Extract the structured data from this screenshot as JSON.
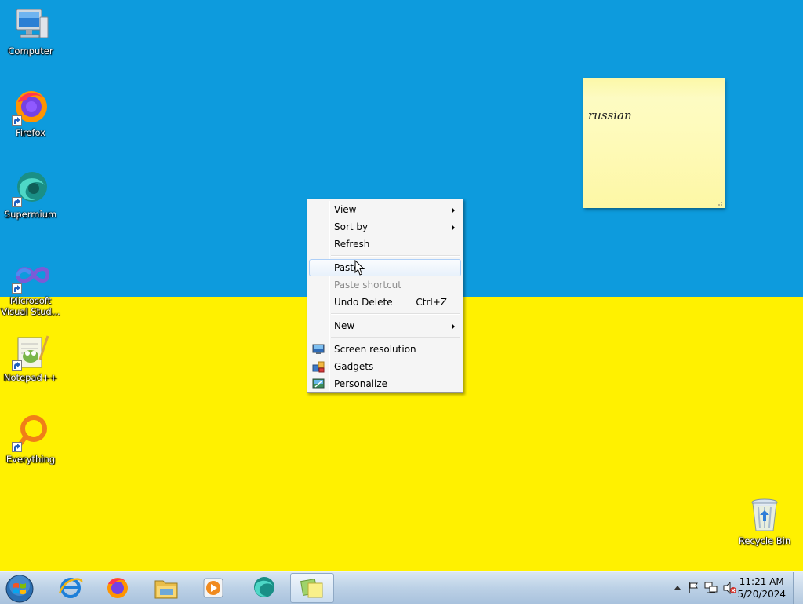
{
  "desktop": {
    "colors": {
      "top": "#0d9bdd",
      "bottom": "#fff100"
    },
    "icons": [
      {
        "label": "Computer",
        "icon": "computer-icon"
      },
      {
        "label": "Firefox",
        "icon": "firefox-icon"
      },
      {
        "label": "Supermium",
        "icon": "supermium-icon"
      },
      {
        "label": "Microsoft Visual Stud...",
        "icon": "visual-studio-icon"
      },
      {
        "label": "Notepad++",
        "icon": "notepad-plus-plus-icon"
      },
      {
        "label": "Everything",
        "icon": "everything-icon"
      },
      {
        "label": "Recycle Bin",
        "icon": "recycle-bin-icon"
      }
    ]
  },
  "sticky_note": {
    "text": "russian"
  },
  "context_menu": {
    "items": [
      {
        "label": "View",
        "submenu": true
      },
      {
        "label": "Sort by",
        "submenu": true
      },
      {
        "label": "Refresh"
      },
      {
        "label": "Paste",
        "hover": true
      },
      {
        "label": "Paste shortcut",
        "disabled": true
      },
      {
        "label": "Undo Delete",
        "accelerator": "Ctrl+Z"
      },
      {
        "label": "New",
        "submenu": true
      },
      {
        "label": "Screen resolution",
        "icon": "screen-resolution-icon"
      },
      {
        "label": "Gadgets",
        "icon": "gadgets-icon"
      },
      {
        "label": "Personalize",
        "icon": "personalize-icon"
      }
    ]
  },
  "taskbar": {
    "pinned": [
      "internet-explorer-icon",
      "firefox-icon",
      "file-explorer-icon",
      "media-player-icon",
      "supermium-icon",
      "sticky-notes-icon"
    ],
    "tray_icons": [
      "show-hidden-icons-arrow",
      "action-center-flag-icon",
      "network-icon",
      "volume-muted-icon"
    ],
    "clock": {
      "time": "11:21 AM",
      "date": "5/20/2024"
    }
  }
}
